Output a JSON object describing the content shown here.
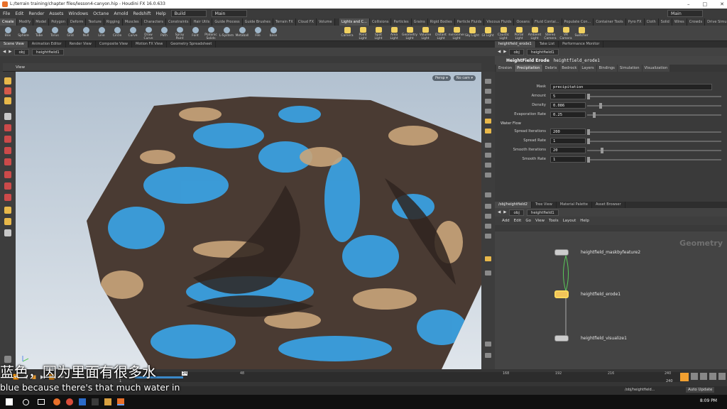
{
  "window": {
    "title": "L:/terrain training/chapter files/lesson4-canyon.hip - Houdini FX 16.0.633"
  },
  "menubar": {
    "items": [
      "File",
      "Edit",
      "Render",
      "Assets",
      "Windows",
      "Octane",
      "Arnold",
      "Redshift",
      "Help"
    ],
    "desktop": "Build",
    "context": "Main",
    "right_desktop": "Main"
  },
  "shelf_tabs_left": [
    "Create",
    "Modify",
    "Model",
    "Polygon",
    "Deform",
    "Texture",
    "Rigging",
    "Muscles",
    "Characters",
    "Constraints",
    "Hair Utils",
    "Guide Process",
    "Guide Brushes",
    "Terrain FX",
    "Cloud FX",
    "Volume"
  ],
  "shelf_tabs_right": [
    "Lights and C...",
    "Collisions",
    "Particles",
    "Grains",
    "Rigid Bodies",
    "Particle Fluids",
    "Viscous Fluids",
    "Oceans",
    "Fluid Contai...",
    "Populate Con...",
    "Container Tools",
    "Pyro FX",
    "Cloth",
    "Solid",
    "Wires",
    "Crowds",
    "Drive Simula..."
  ],
  "shelf_tools_left": [
    "Box",
    "Sphere",
    "Tube",
    "Torus",
    "Grid",
    "Null",
    "Line",
    "Circle",
    "Curve",
    "Draw Curve",
    "Path",
    "Spray Paint",
    "Font",
    "Platonic Solids",
    "L-System",
    "Metaball",
    "File",
    "base"
  ],
  "shelf_tools_right": [
    "Camera",
    "Point Light",
    "Spot Light",
    "Area Light",
    "Geometry Light",
    "Volume Light",
    "Distant Light",
    "Environment Light",
    "Sky Light",
    "GI Light",
    "Caustic Light",
    "Portal Light",
    "Ambient Light",
    "Stereo Camera",
    "VR Camera",
    "Switcher"
  ],
  "left_pane": {
    "tabs": [
      "Scene View",
      "Animation Editor",
      "Render View",
      "Composite View",
      "Motion FX View",
      "Geometry Spreadsheet"
    ],
    "path": [
      "obj",
      "heightfield1"
    ],
    "view_label": "View",
    "persp": "Persp ▾",
    "cam": "No cam ▾"
  },
  "param_pane": {
    "tabs": [
      "heightfield_erode1",
      "Take List",
      "Performance Monitor"
    ],
    "path": [
      "obj",
      "heightfield1"
    ],
    "node_type": "HeightField Erode",
    "node_name": "heightfield_erode1",
    "sub_tabs": [
      "Erosion",
      "Precipitation",
      "Debris",
      "Bedrock",
      "Layers",
      "Bindings",
      "Simulation",
      "Visualization"
    ],
    "mask": {
      "label": "Mask",
      "value": "precipitation"
    },
    "amount": {
      "label": "Amount",
      "value": "5",
      "pos": 0.0
    },
    "density": {
      "label": "Density",
      "value": "0.086",
      "pos": 0.09
    },
    "evaporation": {
      "label": "Evaporation Rate",
      "value": "0.25",
      "pos": 0.04
    },
    "water_flow_label": "Water Flow",
    "spread_iter": {
      "label": "Spread Iterations",
      "value": "200",
      "pos": 0.0
    },
    "spread_rate": {
      "label": "Spread Rate",
      "value": "1",
      "pos": 0.0
    },
    "smooth_iter": {
      "label": "Smooth Iterations",
      "value": "20",
      "pos": 0.1
    },
    "smooth_rate": {
      "label": "Smooth Rate",
      "value": "1",
      "pos": 0.0
    }
  },
  "network_pane": {
    "tabs": [
      "/obj/heightfield2",
      "Tree View",
      "Material Palette",
      "Asset Browser"
    ],
    "path": [
      "obj",
      "heightfield1"
    ],
    "menu": [
      "Add",
      "Edit",
      "Go",
      "View",
      "Tools",
      "Layout",
      "Help"
    ],
    "context_label": "Geometry",
    "nodes": [
      "heightfield_maskbyfeature2",
      "heightfield_erode1",
      "heightfield_visualize1"
    ]
  },
  "timeline": {
    "frame": "24",
    "start": "1",
    "start2": "1",
    "ticks": [
      "24",
      "48",
      "168",
      "192",
      "216"
    ],
    "end": "240",
    "end2": "240",
    "current_marker": "24"
  },
  "status": {
    "path": "/obj/heightfield...",
    "auto_update": "Auto Update"
  },
  "subtitles": {
    "zh": "蓝色，因为里面有很多水",
    "en": "blue because there's that much water in"
  },
  "taskbar": {
    "time": "8:09 PM"
  },
  "colors": {
    "accent": "#f2c45a",
    "water": "#3aa0e0",
    "rock": "#4a3b33",
    "sand": "#c9a57a"
  }
}
